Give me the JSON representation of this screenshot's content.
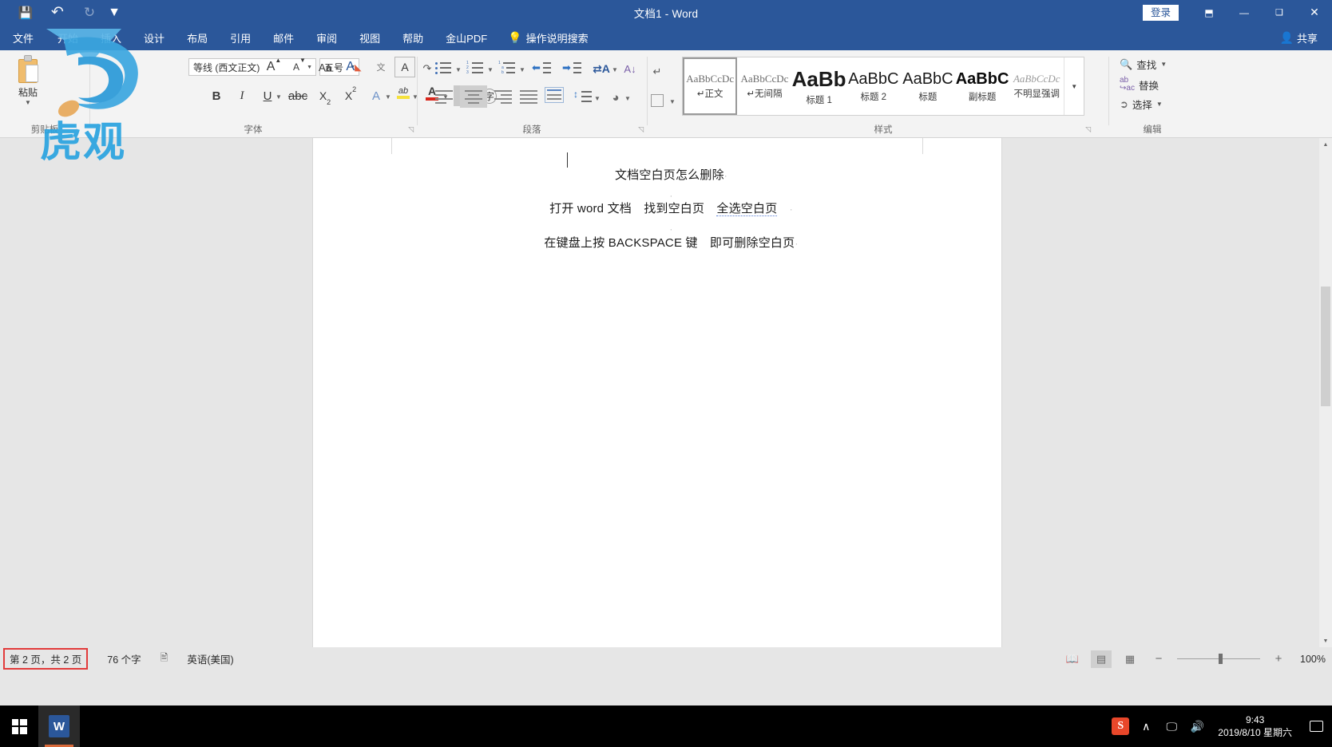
{
  "window": {
    "title": "文档1  -  Word",
    "signin_label": "登录",
    "quick_access": [
      {
        "name": "save-icon",
        "glyph": "💾"
      },
      {
        "name": "undo-icon",
        "glyph": "↶"
      },
      {
        "name": "redo-icon",
        "glyph": "↻"
      }
    ],
    "ribbon_display_glyph": "⬒",
    "minimize_glyph": "—",
    "maximize_glyph": "❑",
    "close_glyph": "✕",
    "accent_color": "#2b579a"
  },
  "tabs": [
    {
      "label": "文件"
    },
    {
      "label": "开始"
    },
    {
      "label": "插入"
    },
    {
      "label": "设计"
    },
    {
      "label": "布局"
    },
    {
      "label": "引用"
    },
    {
      "label": "邮件"
    },
    {
      "label": "审阅"
    },
    {
      "label": "视图"
    },
    {
      "label": "帮助"
    },
    {
      "label": "金山PDF"
    }
  ],
  "tellme": {
    "label": "操作说明搜索",
    "icon": "lightbulb-icon"
  },
  "share": {
    "label": "共享",
    "icon": "share-person-icon"
  },
  "ribbon": {
    "groups": [
      {
        "label": "剪贴板"
      },
      {
        "label": "字体"
      },
      {
        "label": "段落"
      },
      {
        "label": "样式"
      },
      {
        "label": "编辑"
      }
    ],
    "clipboard": {
      "paste_label": "粘贴"
    },
    "font": {
      "font_name": "等线 (西文正文)",
      "font_size": "五号",
      "grow_label": "A",
      "shrink_label": "A",
      "case_label": "Aa",
      "clear_label": "A",
      "phonetic_label": "文",
      "border_label": "A",
      "bold_label": "B",
      "italic_label": "I",
      "underline_label": "U",
      "strike_label": "abc",
      "subscript_label": "X",
      "superscript_label": "X",
      "texteffect_label": "A",
      "highlight_label": "ab",
      "fontcolor_label": "A",
      "charshade_label": "A",
      "enclose_label": "字"
    },
    "paragraph": {
      "bullets": "项目符号",
      "numbering": "编号",
      "multilevel": "多级列表",
      "decrease_indent": "减少缩进量",
      "increase_indent": "增加缩进量",
      "cn_layout": "中文版式",
      "sort": "排序",
      "show_marks": "显示编辑标记",
      "align_left": "左对齐",
      "align_center": "居中",
      "align_right": "右对齐",
      "justify": "两端对齐",
      "distribute": "分散对齐",
      "line_spacing": "行和段落间距",
      "shading": "底纹",
      "borders": "边框"
    },
    "styles": [
      {
        "preview": "AaBbCcDc",
        "name": "正文",
        "mark": "↵",
        "selected": true,
        "kind": "body"
      },
      {
        "preview": "AaBbCcDc",
        "name": "无间隔",
        "mark": "↵",
        "selected": false,
        "kind": "body"
      },
      {
        "preview": "AaBb",
        "name": "标题 1",
        "mark": "",
        "selected": false,
        "kind": "h1"
      },
      {
        "preview": "AaBbC",
        "name": "标题 2",
        "mark": "",
        "selected": false,
        "kind": "h2"
      },
      {
        "preview": "AaBbC",
        "name": "标题",
        "mark": "",
        "selected": false,
        "kind": "t"
      },
      {
        "preview": "AaBbC",
        "name": "副标题",
        "mark": "",
        "selected": false,
        "kind": "bw"
      },
      {
        "preview": "AaBbCcDc",
        "name": "不明显强调",
        "mark": "",
        "selected": false,
        "kind": "em"
      }
    ],
    "editing": [
      {
        "label": "查找",
        "icon": "search-icon",
        "caret": true
      },
      {
        "label": "替换",
        "icon": "replace-icon",
        "caret": false
      },
      {
        "label": "选择",
        "icon": "select-pointer-icon",
        "caret": true
      }
    ]
  },
  "document": {
    "lines": [
      {
        "text": "文档空白页怎么删除",
        "pilcrow": "·",
        "underlined": "",
        "tail": ""
      },
      {
        "text": "",
        "pilcrow": "·",
        "underlined": "",
        "tail": ""
      },
      {
        "text": "打开 word 文档　找到空白页　",
        "pilcrow": "·",
        "underlined": "全选空白页",
        "tail": "　"
      },
      {
        "text": "",
        "pilcrow": "·",
        "underlined": "",
        "tail": ""
      },
      {
        "text": "在键盘上按 BACKSPACE 键　即可删除空白页",
        "pilcrow": "·",
        "underlined": "",
        "tail": ""
      }
    ]
  },
  "statusbar": {
    "pages": "第 2 页，共 2 页",
    "words": "76 个字",
    "proofing_icon": "proofing-errors-icon",
    "language": "英语(美国)",
    "views": [
      {
        "name": "read-mode-view-button",
        "glyph": "📖",
        "selected": false
      },
      {
        "name": "print-layout-view-button",
        "glyph": "▤",
        "selected": true
      },
      {
        "name": "web-layout-view-button",
        "glyph": "▦",
        "selected": false
      }
    ],
    "zoom_out": "−",
    "zoom_in": "+",
    "zoom_level": "100%",
    "highlight_color": "#e23b3b"
  },
  "taskbar": {
    "start_name": "windows-start-button",
    "app_label": "W",
    "tray": [
      {
        "name": "sogou-ime-icon",
        "glyph": "S"
      },
      {
        "name": "show-hidden-icons-chevron",
        "glyph": "∧"
      },
      {
        "name": "network-icon",
        "glyph": "🖵"
      },
      {
        "name": "volume-icon",
        "glyph": "🔊"
      }
    ],
    "time": "9:43",
    "date": "2019/8/10 星期六",
    "notification_name": "action-center-icon"
  },
  "watermark": {
    "text": "虎观"
  }
}
